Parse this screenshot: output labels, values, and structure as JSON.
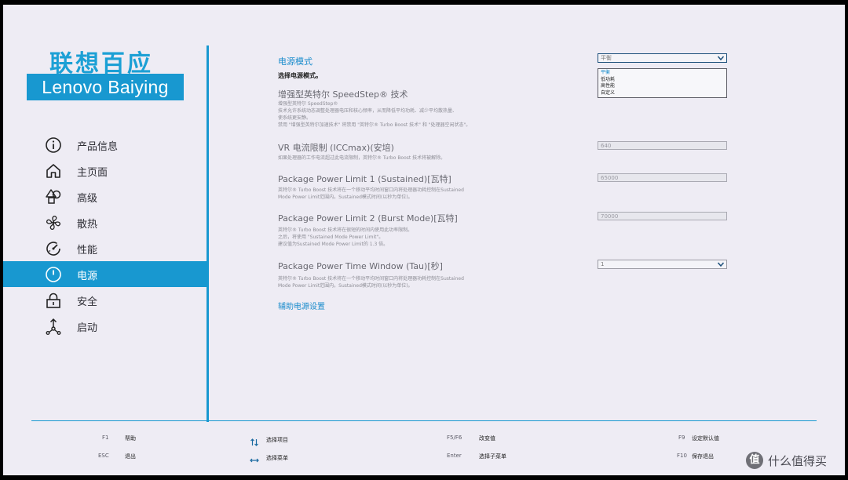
{
  "brand": {
    "chinese": "联想百应",
    "english": "Lenovo Baiying"
  },
  "nav": {
    "items": [
      {
        "label": "产品信息",
        "icon": "info-icon"
      },
      {
        "label": "主页面",
        "icon": "home-icon"
      },
      {
        "label": "高级",
        "icon": "shapes-icon"
      },
      {
        "label": "散热",
        "icon": "fan-icon"
      },
      {
        "label": "性能",
        "icon": "gauge-icon"
      },
      {
        "label": "电源",
        "icon": "power-icon",
        "active": true
      },
      {
        "label": "安全",
        "icon": "lock-icon"
      },
      {
        "label": "启动",
        "icon": "boot-icon"
      }
    ]
  },
  "power_mode": {
    "title": "电源模式",
    "subtitle": "选择电源模式。",
    "selected": "平衡",
    "options": [
      "平衡",
      "低功耗",
      "高性能",
      "自定义"
    ]
  },
  "speedstep": {
    "title": "增强型英特尔 SpeedStep® 技术",
    "desc": [
      "增强型英特尔 SpeedStep®",
      "技术允许系统动态调整处理器电压和核心频率，从而降低平均功耗、减少平均散热量、",
      "使系统更安静。",
      "禁用 \"增强型英特尔加速技术\" 将禁用 \"英特尔® Turbo Boost 技术\" 和 \"处理器空闲状态\"。"
    ]
  },
  "vr_limit": {
    "title": "VR 电流限制 (ICCmax)(安培)",
    "value": "640",
    "desc": [
      "如果处理器的工作电流超过此电流限制，英特尔® Turbo Boost 技术将被解除。"
    ]
  },
  "pl1": {
    "title": "Package Power Limit 1 (Sustained)[瓦特]",
    "value": "65000",
    "desc": [
      "英特尔® Turbo Boost 技术将在一个移动平均时间窗口内将处理器功耗控制在Sustained",
      "Mode Power Limit范围内。Sustained模式时间(以秒为单位)。"
    ]
  },
  "pl2": {
    "title": "Package Power Limit 2 (Burst Mode)[瓦特]",
    "value": "70000",
    "desc": [
      "英特尔® Turbo Boost 技术将在很短的时间内使用此功率限制。",
      "之后，将使用 \"Sustained Mode Power Limit\"。",
      "建议值为Sustained Mode Power Limit的 1.3 倍。"
    ]
  },
  "tau": {
    "title": "Package Power Time Window (Tau)[秒]",
    "value": "1",
    "desc": [
      "英特尔® Turbo Boost 技术将在一个移动平均时间窗口内将处理器功耗控制在Sustained",
      " Mode Power Limit范围内。Sustained模式时间(以秒为单位)。"
    ]
  },
  "aux_link": "辅助电源设置",
  "footer": {
    "f1_key": "F1",
    "f1_desc": "帮助",
    "esc_key": "ESC",
    "esc_desc": "退出",
    "select_item": "选择项目",
    "select_menu": "选择菜单",
    "f5f6_key": "F5/F6",
    "f5f6_desc": "改变值",
    "enter_key": "Enter",
    "enter_desc": "选择子菜单",
    "f9_key": "F9",
    "f9_desc": "设定默认值",
    "f10_key": "F10",
    "f10_desc": "保存退出"
  },
  "watermark": {
    "logo": "值",
    "text": "什么值得买"
  },
  "colors": {
    "accent": "#1898d0",
    "background": "#eeecf4",
    "link": "#1a8ccc"
  }
}
